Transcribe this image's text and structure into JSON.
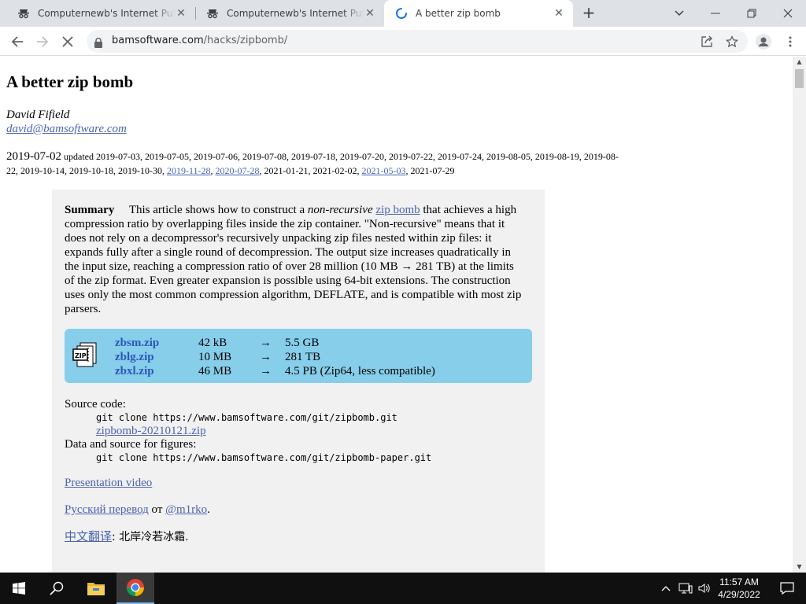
{
  "browser": {
    "tabs": [
      {
        "title": "Computernewb's Internet Pub Hub",
        "active": false
      },
      {
        "title": "Computernewb's Internet Pub Hub",
        "active": false
      },
      {
        "title": "A better zip bomb",
        "active": true
      }
    ],
    "url_host": "bamsoftware.com",
    "url_path": "/hacks/zipbomb/"
  },
  "article": {
    "title": "A better zip bomb",
    "author": "David Fifield",
    "email": "david@bamsoftware.com",
    "date_first": "2019-07-02",
    "updated_label": "updated",
    "updates_plain_1": "2019-07-03, 2019-07-05, 2019-07-06, 2019-07-08, 2019-07-18, 2019-07-20, 2019-07-22, 2019-07-24, 2019-08-05, 2019-08-19, 2019-08-22, 2019-10-14, 2019-10-18, 2019-10-30,",
    "update_link_1": "2019-11-28",
    "update_link_2": "2020-07-28",
    "updates_plain_2": "2021-01-21, 2021-02-02,",
    "update_link_3": "2021-05-03",
    "updates_plain_3": "2021-07-29",
    "summary_label": "Summary",
    "summary_pre": "This article shows how to construct a",
    "summary_em": "non-recursive",
    "summary_link": "zip bomb",
    "summary_post": "that achieves a high compression ratio by overlapping files inside the zip container. \"Non-recursive\" means that it does not rely on a decompressor's recursively unpacking zip files nested within zip files: it expands fully after a single round of decompression. The output size increases quadratically in the input size, reaching a compression ratio of over 28 million (10 MB → 281 TB) at the limits of the zip format. Even greater expansion is possible using 64-bit extensions. The construction uses only the most common compression algorithm, DEFLATE, and is compatible with most zip parsers.",
    "files": [
      {
        "name": "zbsm.zip",
        "size": "42 kB",
        "arrow": "→",
        "output": "5.5 GB"
      },
      {
        "name": "zblg.zip",
        "size": "10 MB",
        "arrow": "→",
        "output": "281 TB"
      },
      {
        "name": "zbxl.zip",
        "size": "46 MB",
        "arrow": "→",
        "output": "4.5 PB (Zip64, less compatible)"
      }
    ],
    "source_label": "Source code:",
    "source_cmd": "git clone https://www.bamsoftware.com/git/zipbomb.git",
    "source_zip": "zipbomb-20210121.zip",
    "data_label": "Data and source for figures:",
    "data_cmd": "git clone https://www.bamsoftware.com/git/zipbomb-paper.git",
    "video_link": "Presentation video",
    "ru_link": "Русский перевод",
    "ru_from": "от",
    "ru_author": "@m1rko",
    "ru_end": ".",
    "zh_link": "中文翻译",
    "zh_rest": ": 北岸冷若冰霜."
  },
  "taskbar": {
    "time": "11:57 AM",
    "date": "4/29/2022"
  },
  "colors": {
    "tab_bg": "#dee1e6",
    "link": "#4a64b0",
    "file_box": "#87ceeb",
    "summary_bg": "#f1f1f1",
    "taskbar": "#101010"
  }
}
